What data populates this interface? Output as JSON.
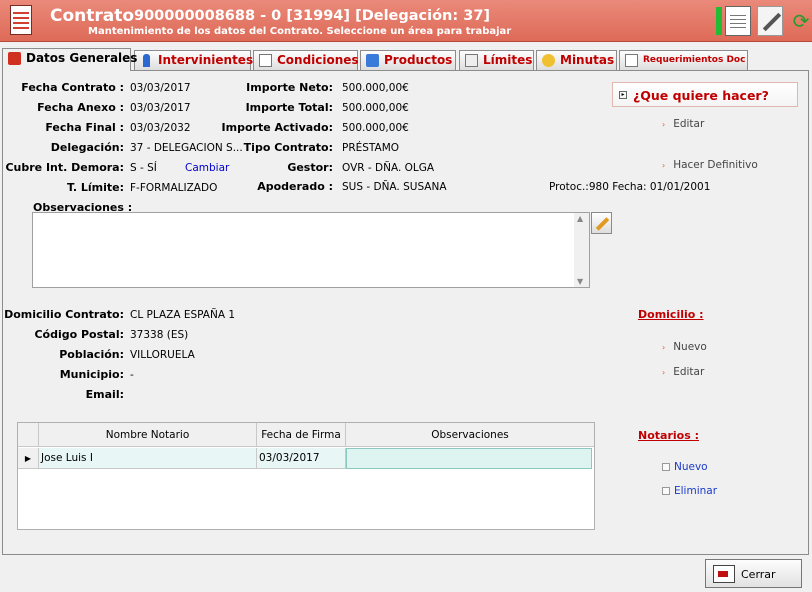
{
  "header": {
    "title": "Contrato",
    "code": "900000008688 - 0 [31994] [Delegación: 37]",
    "subtitle": "Mantenimiento de los datos del Contrato. Seleccione un área para trabajar",
    "toolbar_icons": [
      "document-icon",
      "edit-icon",
      "refresh-icon"
    ],
    "colors": {
      "header": "#de6a58",
      "accent": "#c00000"
    }
  },
  "tabs": [
    {
      "label": "Datos Generales",
      "icon": "contract-icon"
    },
    {
      "label": "Intervinientes",
      "icon": "person-icon"
    },
    {
      "label": "Condiciones",
      "icon": "document-icon"
    },
    {
      "label": "Productos",
      "icon": "cube-icon"
    },
    {
      "label": "Límites",
      "icon": "filter-icon"
    },
    {
      "label": "Minutas",
      "icon": "bulb-icon"
    },
    {
      "label": "Requerimientos Doc",
      "icon": "doc-list-icon"
    }
  ],
  "general": {
    "fecha_contrato": {
      "label": "Fecha Contrato :",
      "value": "03/03/2017"
    },
    "fecha_anexo": {
      "label": "Fecha Anexo :",
      "value": "03/03/2017"
    },
    "fecha_final": {
      "label": "Fecha Final :",
      "value": "03/03/2032"
    },
    "delegacion": {
      "label": "Delegación:",
      "value": "37 - DELEGACION S..."
    },
    "cubre_int": {
      "label": "Cubre Int. Demora:",
      "value": "S - SÍ",
      "link": "Cambiar"
    },
    "t_limite": {
      "label": "T. Límite:",
      "value": "F-FORMALIZADO"
    },
    "importe_neto": {
      "label": "Importe Neto:",
      "value": "500.000,00€"
    },
    "importe_total": {
      "label": "Importe Total:",
      "value": "500.000,00€"
    },
    "importe_activado": {
      "label": "Importe Activado:",
      "value": "500.000,00€"
    },
    "tipo_contrato": {
      "label": "Tipo Contrato:",
      "value": "PRÉSTAMO"
    },
    "gestor": {
      "label": "Gestor:",
      "value": "OVR - DÑA. OLGA"
    },
    "apoderado": {
      "label": "Apoderado :",
      "value": "SUS - DÑA. SUSANA"
    },
    "protoc": "Protoc.:980 Fecha: 01/01/2001",
    "observaciones_label": "Observaciones :"
  },
  "actions": {
    "title": "¿Que quiere hacer?",
    "items": [
      "Editar",
      "Hacer Definitivo"
    ]
  },
  "domicilio": {
    "domicilio_contrato": {
      "label": "Domicilio Contrato:",
      "value": "CL PLAZA ESPAÑA 1"
    },
    "codigo_postal": {
      "label": "Código Postal:",
      "value": "37338 (ES)"
    },
    "poblacion": {
      "label": "Población:",
      "value": "VILLORUELA"
    },
    "municipio": {
      "label": "Municipio:",
      "value": "-"
    },
    "email": {
      "label": "Email:",
      "value": ""
    },
    "side_title": "Domicilio :",
    "side_actions": [
      "Nuevo",
      "Editar"
    ]
  },
  "notarios": {
    "columns": [
      "Nombre Notario",
      "Fecha de Firma",
      "Observaciones"
    ],
    "rows": [
      {
        "nombre": "Jose Luis I",
        "fecha": "03/03/2017",
        "obs": ""
      }
    ],
    "side_title": "Notarios :",
    "side_actions": [
      "Nuevo",
      "Eliminar"
    ]
  },
  "footer": {
    "close_label": "Cerrar"
  }
}
